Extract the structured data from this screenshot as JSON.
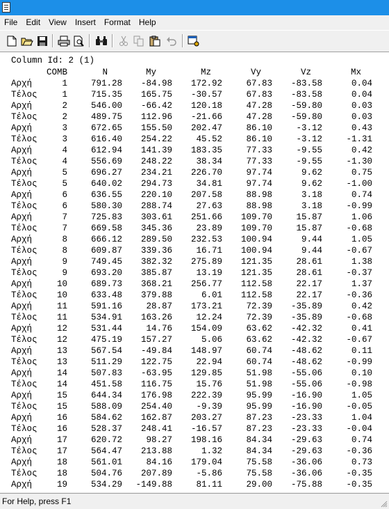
{
  "menu": [
    "File",
    "Edit",
    "View",
    "Insert",
    "Format",
    "Help"
  ],
  "toolbar_icons": [
    "new-file-icon",
    "open-folder-icon",
    "save-icon",
    "print-icon",
    "print-preview-icon",
    "find-icon",
    "cut-icon",
    "copy-icon",
    "paste-icon",
    "undo-icon",
    "properties-icon"
  ],
  "document": {
    "column_id_line": "Column Id: 2 (1)",
    "headers": {
      "comb": "COMB",
      "n": "N",
      "my": "My",
      "mz": "Mz",
      "vy": "Vy",
      "vz": "Vz",
      "mx": "Mx"
    },
    "rows": [
      {
        "pos": "Αρχή",
        "comb": "1",
        "n": "791.28",
        "my": "-84.98",
        "mz": "172.92",
        "vy": "67.83",
        "vz": "-83.58",
        "mx": "0.04"
      },
      {
        "pos": "Τέλος",
        "comb": "1",
        "n": "715.35",
        "my": "165.75",
        "mz": "-30.57",
        "vy": "67.83",
        "vz": "-83.58",
        "mx": "0.04"
      },
      {
        "pos": "Αρχή",
        "comb": "2",
        "n": "546.00",
        "my": "-66.42",
        "mz": "120.18",
        "vy": "47.28",
        "vz": "-59.80",
        "mx": "0.03"
      },
      {
        "pos": "Τέλος",
        "comb": "2",
        "n": "489.75",
        "my": "112.96",
        "mz": "-21.66",
        "vy": "47.28",
        "vz": "-59.80",
        "mx": "0.03"
      },
      {
        "pos": "Αρχή",
        "comb": "3",
        "n": "672.65",
        "my": "155.50",
        "mz": "202.47",
        "vy": "86.10",
        "vz": "-3.12",
        "mx": "0.43"
      },
      {
        "pos": "Τέλος",
        "comb": "3",
        "n": "616.40",
        "my": "254.22",
        "mz": "45.52",
        "vy": "86.10",
        "vz": "-3.12",
        "mx": "-1.31"
      },
      {
        "pos": "Αρχή",
        "comb": "4",
        "n": "612.94",
        "my": "141.39",
        "mz": "183.35",
        "vy": "77.33",
        "vz": "-9.55",
        "mx": "0.42"
      },
      {
        "pos": "Τέλος",
        "comb": "4",
        "n": "556.69",
        "my": "248.22",
        "mz": "38.34",
        "vy": "77.33",
        "vz": "-9.55",
        "mx": "-1.30"
      },
      {
        "pos": "Αρχή",
        "comb": "5",
        "n": "696.27",
        "my": "234.21",
        "mz": "226.70",
        "vy": "97.74",
        "vz": "9.62",
        "mx": "0.75"
      },
      {
        "pos": "Τέλος",
        "comb": "5",
        "n": "640.02",
        "my": "294.73",
        "mz": "34.81",
        "vy": "97.74",
        "vz": "9.62",
        "mx": "-1.00"
      },
      {
        "pos": "Αρχή",
        "comb": "6",
        "n": "636.55",
        "my": "220.10",
        "mz": "207.58",
        "vy": "88.98",
        "vz": "3.18",
        "mx": "0.74"
      },
      {
        "pos": "Τέλος",
        "comb": "6",
        "n": "580.30",
        "my": "288.74",
        "mz": "27.63",
        "vy": "88.98",
        "vz": "3.18",
        "mx": "-0.99"
      },
      {
        "pos": "Αρχή",
        "comb": "7",
        "n": "725.83",
        "my": "303.61",
        "mz": "251.66",
        "vy": "109.70",
        "vz": "15.87",
        "mx": "1.06"
      },
      {
        "pos": "Τέλος",
        "comb": "7",
        "n": "669.58",
        "my": "345.36",
        "mz": "23.89",
        "vy": "109.70",
        "vz": "15.87",
        "mx": "-0.68"
      },
      {
        "pos": "Αρχή",
        "comb": "8",
        "n": "666.12",
        "my": "289.50",
        "mz": "232.53",
        "vy": "100.94",
        "vz": "9.44",
        "mx": "1.05"
      },
      {
        "pos": "Τέλος",
        "comb": "8",
        "n": "609.87",
        "my": "339.36",
        "mz": "16.71",
        "vy": "100.94",
        "vz": "9.44",
        "mx": "-0.67"
      },
      {
        "pos": "Αρχή",
        "comb": "9",
        "n": "749.45",
        "my": "382.32",
        "mz": "275.89",
        "vy": "121.35",
        "vz": "28.61",
        "mx": "1.38"
      },
      {
        "pos": "Τέλος",
        "comb": "9",
        "n": "693.20",
        "my": "385.87",
        "mz": "13.19",
        "vy": "121.35",
        "vz": "28.61",
        "mx": "-0.37"
      },
      {
        "pos": "Αρχή",
        "comb": "10",
        "n": "689.73",
        "my": "368.21",
        "mz": "256.77",
        "vy": "112.58",
        "vz": "22.17",
        "mx": "1.37"
      },
      {
        "pos": "Τέλος",
        "comb": "10",
        "n": "633.48",
        "my": "379.88",
        "mz": "6.01",
        "vy": "112.58",
        "vz": "22.17",
        "mx": "-0.36"
      },
      {
        "pos": "Αρχή",
        "comb": "11",
        "n": "591.16",
        "my": "28.87",
        "mz": "173.21",
        "vy": "72.39",
        "vz": "-35.89",
        "mx": "0.42"
      },
      {
        "pos": "Τέλος",
        "comb": "11",
        "n": "534.91",
        "my": "163.26",
        "mz": "12.24",
        "vy": "72.39",
        "vz": "-35.89",
        "mx": "-0.68"
      },
      {
        "pos": "Αρχή",
        "comb": "12",
        "n": "531.44",
        "my": "14.76",
        "mz": "154.09",
        "vy": "63.62",
        "vz": "-42.32",
        "mx": "0.41"
      },
      {
        "pos": "Τέλος",
        "comb": "12",
        "n": "475.19",
        "my": "157.27",
        "mz": "5.06",
        "vy": "63.62",
        "vz": "-42.32",
        "mx": "-0.67"
      },
      {
        "pos": "Αρχή",
        "comb": "13",
        "n": "567.54",
        "my": "-49.84",
        "mz": "148.97",
        "vy": "60.74",
        "vz": "-48.62",
        "mx": "0.11"
      },
      {
        "pos": "Τέλος",
        "comb": "13",
        "n": "511.29",
        "my": "122.75",
        "mz": "22.94",
        "vy": "60.74",
        "vz": "-48.62",
        "mx": "-0.99"
      },
      {
        "pos": "Αρχή",
        "comb": "14",
        "n": "507.83",
        "my": "-63.95",
        "mz": "129.85",
        "vy": "51.98",
        "vz": "-55.06",
        "mx": "0.10"
      },
      {
        "pos": "Τέλος",
        "comb": "14",
        "n": "451.58",
        "my": "116.75",
        "mz": "15.76",
        "vy": "51.98",
        "vz": "-55.06",
        "mx": "-0.98"
      },
      {
        "pos": "Αρχή",
        "comb": "15",
        "n": "644.34",
        "my": "176.98",
        "mz": "222.39",
        "vy": "95.99",
        "vz": "-16.90",
        "mx": "1.05"
      },
      {
        "pos": "Τέλος",
        "comb": "15",
        "n": "588.09",
        "my": "254.40",
        "mz": "-9.39",
        "vy": "95.99",
        "vz": "-16.90",
        "mx": "-0.05"
      },
      {
        "pos": "Αρχή",
        "comb": "16",
        "n": "584.62",
        "my": "162.87",
        "mz": "203.27",
        "vy": "87.23",
        "vz": "-23.33",
        "mx": "1.04"
      },
      {
        "pos": "Τέλος",
        "comb": "16",
        "n": "528.37",
        "my": "248.41",
        "mz": "-16.57",
        "vy": "87.23",
        "vz": "-23.33",
        "mx": "-0.04"
      },
      {
        "pos": "Αρχή",
        "comb": "17",
        "n": "620.72",
        "my": "98.27",
        "mz": "198.16",
        "vy": "84.34",
        "vz": "-29.63",
        "mx": "0.74"
      },
      {
        "pos": "Τέλος",
        "comb": "17",
        "n": "564.47",
        "my": "213.88",
        "mz": "1.32",
        "vy": "84.34",
        "vz": "-29.63",
        "mx": "-0.36"
      },
      {
        "pos": "Αρχή",
        "comb": "18",
        "n": "561.01",
        "my": "84.16",
        "mz": "179.04",
        "vy": "75.58",
        "vz": "-36.06",
        "mx": "0.73"
      },
      {
        "pos": "Τέλος",
        "comb": "18",
        "n": "504.76",
        "my": "207.89",
        "mz": "-5.86",
        "vy": "75.58",
        "vz": "-36.06",
        "mx": "-0.35"
      },
      {
        "pos": "Αρχή",
        "comb": "19",
        "n": "534.29",
        "my": "-149.88",
        "mz": "81.11",
        "vy": "29.00",
        "vz": "-75.88",
        "mx": "-0.35"
      }
    ]
  },
  "status_bar": {
    "text": "For Help, press F1"
  },
  "colors": {
    "titlebar": "#1c8fe8",
    "background": "#f0f0f0",
    "document": "#ffffff"
  }
}
